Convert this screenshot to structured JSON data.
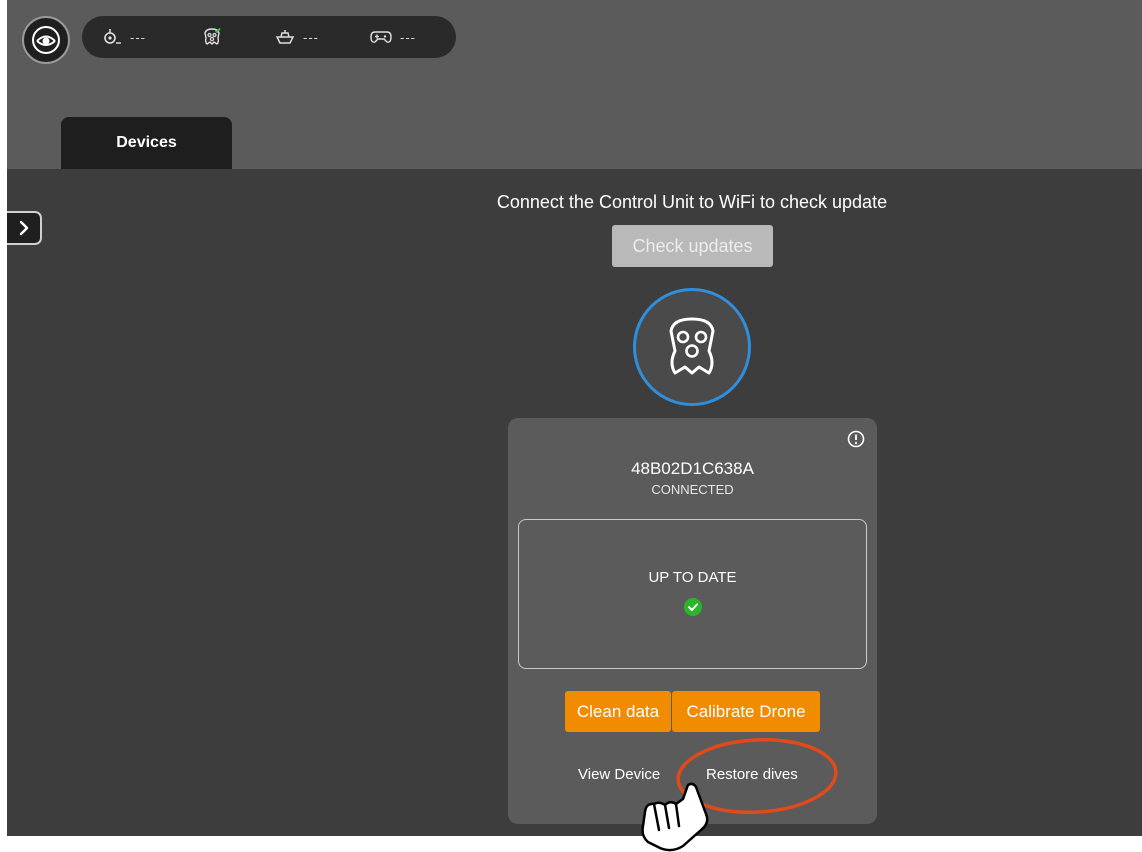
{
  "status_bar": {
    "items": [
      {
        "icon": "diver-icon",
        "value": "---"
      },
      {
        "icon": "drone-icon",
        "value": ""
      },
      {
        "icon": "boat-icon",
        "value": "---"
      },
      {
        "icon": "gamepad-icon",
        "value": "---"
      }
    ],
    "drone_indicator_color": "#2ecc40"
  },
  "tabs": [
    {
      "label": "Devices"
    }
  ],
  "main": {
    "wifi_message": "Connect the Control Unit to WiFi to check update",
    "check_updates_label": "Check updates"
  },
  "device_card": {
    "device_id": "48B02D1C638A",
    "status": "CONNECTED",
    "update_status": "UP TO DATE",
    "clean_data_label": "Clean data",
    "calibrate_label": "Calibrate Drone",
    "view_device_label": "View Device",
    "restore_dives_label": "Restore dives"
  },
  "colors": {
    "accent_orange": "#f18b00",
    "drone_ring_blue": "#2f8fdc",
    "success_green": "#2bb52b",
    "highlight_red": "#e24a1a"
  }
}
